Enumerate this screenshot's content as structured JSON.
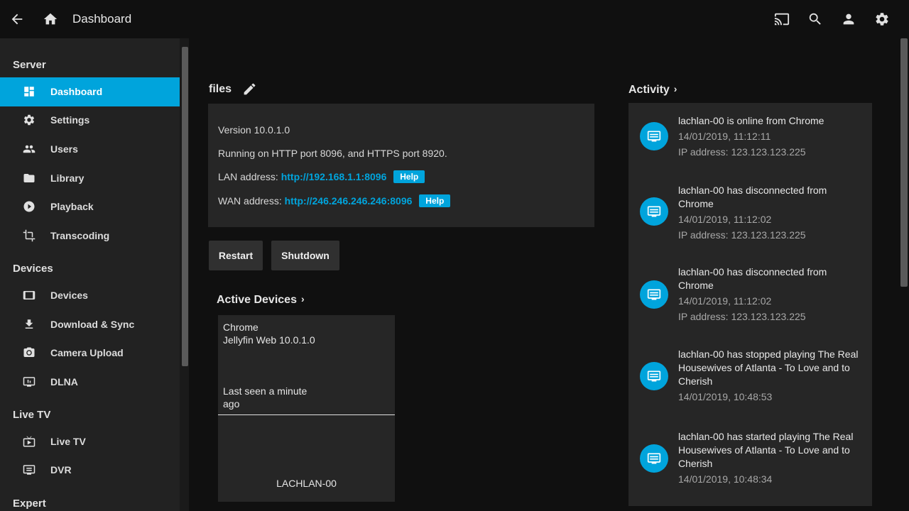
{
  "header": {
    "title": "Dashboard",
    "back_icon": "arrow-back-icon",
    "home_icon": "home-icon",
    "right_icons": [
      "cast-icon",
      "search-icon",
      "user-icon",
      "settings-icon"
    ]
  },
  "sidebar": {
    "sections": [
      {
        "label": "Server",
        "items": [
          {
            "label": "Dashboard",
            "icon": "dashboard-icon",
            "active": true
          },
          {
            "label": "Settings",
            "icon": "gear-icon"
          },
          {
            "label": "Users",
            "icon": "users-icon"
          },
          {
            "label": "Library",
            "icon": "folder-icon"
          },
          {
            "label": "Playback",
            "icon": "play-circle-icon"
          },
          {
            "label": "Transcoding",
            "icon": "crop-icon"
          }
        ]
      },
      {
        "label": "Devices",
        "items": [
          {
            "label": "Devices",
            "icon": "tablet-icon"
          },
          {
            "label": "Download & Sync",
            "icon": "download-icon"
          },
          {
            "label": "Camera Upload",
            "icon": "camera-icon"
          },
          {
            "label": "DLNA",
            "icon": "dlna-icon"
          }
        ]
      },
      {
        "label": "Live TV",
        "items": [
          {
            "label": "Live TV",
            "icon": "live-tv-icon"
          },
          {
            "label": "DVR",
            "icon": "dvr-icon"
          }
        ]
      },
      {
        "label": "Expert",
        "items": []
      }
    ]
  },
  "server": {
    "name": "files",
    "version": "Version 10.0.1.0",
    "ports": "Running on HTTP port 8096, and HTTPS port 8920.",
    "lan_label": "LAN address: ",
    "lan_url": "http://192.168.1.1:8096",
    "wan_label": "WAN address: ",
    "wan_url": "http://246.246.246.246:8096",
    "help_label": "Help",
    "restart_label": "Restart",
    "shutdown_label": "Shutdown"
  },
  "active_devices": {
    "title": "Active Devices",
    "devices": [
      {
        "client": "Chrome",
        "app": "Jellyfin Web 10.0.1.0",
        "last_seen": "Last seen a minute ago",
        "name": "LACHLAN-00"
      }
    ]
  },
  "activity": {
    "title": "Activity",
    "items": [
      {
        "title": "lachlan-00 is online from Chrome",
        "date": "14/01/2019, 11:12:11",
        "ip": "IP address: 123.123.123.225"
      },
      {
        "title": "lachlan-00 has disconnected from Chrome",
        "date": "14/01/2019, 11:12:02",
        "ip": "IP address: 123.123.123.225"
      },
      {
        "title": "lachlan-00 has disconnected from Chrome",
        "date": "14/01/2019, 11:12:02",
        "ip": "IP address: 123.123.123.225"
      },
      {
        "title": "lachlan-00 has stopped playing The Real Housewives of Atlanta - To Love and to Cherish",
        "date": "14/01/2019, 10:48:53",
        "ip": ""
      },
      {
        "title": "lachlan-00 has started playing The Real Housewives of Atlanta - To Love and to Cherish",
        "date": "14/01/2019, 10:48:34",
        "ip": ""
      }
    ]
  },
  "colors": {
    "accent": "#00a4dc",
    "background": "#101010",
    "card": "#262626",
    "sidebar": "#222222"
  }
}
